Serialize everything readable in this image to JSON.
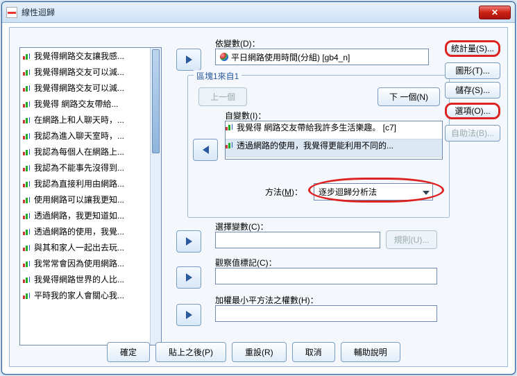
{
  "window": {
    "title": "線性迴歸"
  },
  "source_list": {
    "items": [
      "我覺得網路交友讓我感...",
      "我覺得網路交友可以減...",
      "我覺得網路交友可以減...",
      "我覺得 網路交友帶給...",
      "在網路上和人聊天時，...",
      "我認為進入聊天室時，...",
      "我認為每個人在網路上...",
      "我認為不能事先沒得到...",
      "我認為直接利用由網路...",
      "使用網路可以讓我更知...",
      "透過網路，我更知道如...",
      "透過網路的使用，我覺...",
      "與其和家人一起出去玩...",
      "我常常會因為使用網路...",
      "我覺得網路世界的人比...",
      "平時我的家人會關心我..."
    ]
  },
  "dependent": {
    "label": "依變數(D)：",
    "value": "平日網路使用時間(分組) [gb4_n]"
  },
  "block": {
    "title_prefix": "區塊1來自1",
    "prev": "上一個",
    "next": "下 一個(N)",
    "iv_label": "自變數(I)：",
    "iv_items": [
      "我覺得 網路交友帶給我許多生活樂趣。 [c7]",
      "透過網路的使用，我覺得更能利用不同的..."
    ],
    "method_label": "方法(M)：",
    "method_value": "逐步迴歸分析法"
  },
  "select_var": {
    "label": "選擇變數(C)：",
    "rule_btn": "規則(U)..."
  },
  "case_label": {
    "label": "觀察值標記(C)："
  },
  "wls": {
    "label": "加權最小平方法之權數(H)："
  },
  "side": {
    "stats": "統計量(S)...",
    "plots": "圖形(T)...",
    "save": "儲存(S)...",
    "options": "選項(O)...",
    "bootstrap": "自助法(B)..."
  },
  "bottom": {
    "ok": "確定",
    "paste": "貼上之後(P)",
    "reset": "重設(R)",
    "cancel": "取消",
    "help": "輔助說明"
  }
}
